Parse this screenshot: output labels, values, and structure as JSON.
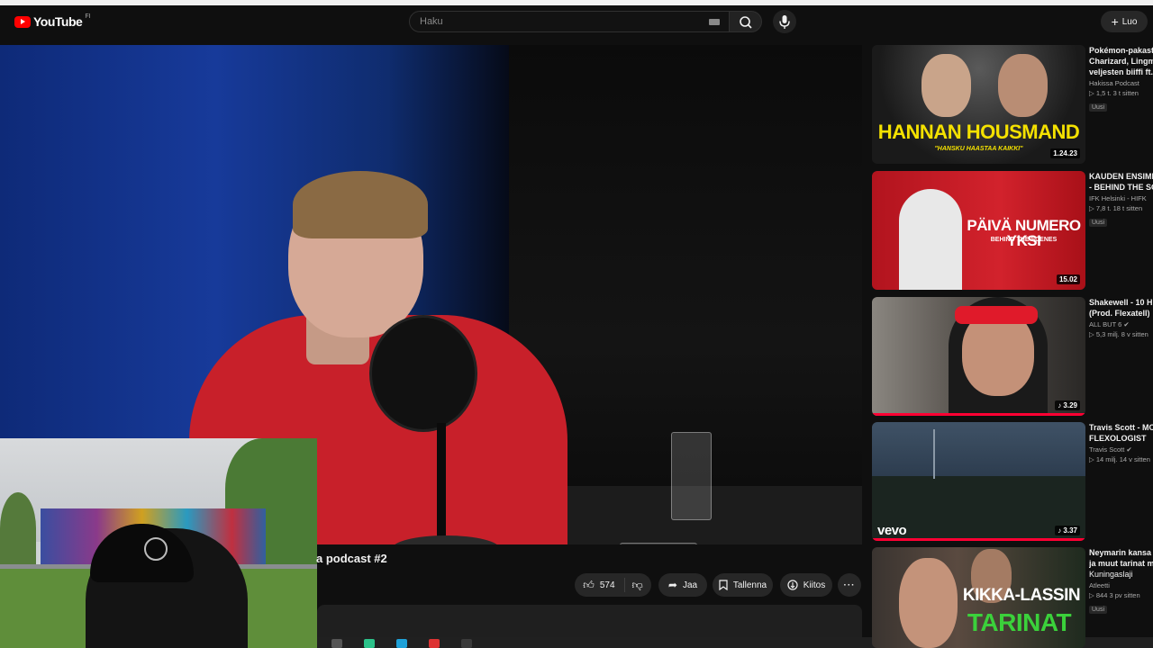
{
  "masthead": {
    "logo_text": "YouTube",
    "country_code": "FI",
    "search_placeholder": "Haku",
    "create_label": "Luo"
  },
  "video": {
    "title": "a podcast #2",
    "likes": "574",
    "share_label": "Jaa",
    "save_label": "Tallenna",
    "thanks_label": "Kiitos"
  },
  "recommendations": [
    {
      "title_line1": "Pokémon-pakast",
      "title_line2": "Charizard, Lingm",
      "title_line3": "veljesten biiffi ft.",
      "channel": "Hakissa Podcast",
      "stats": "▷ 1,5 t.  3 t sitten",
      "badge": "Uusi",
      "duration": "1.24.23",
      "thumb_headline": "HANNAN HOUSMAND",
      "thumb_sub": "\"HANSKU HAASTAA KAIKKI\""
    },
    {
      "title_line1": "KAUDEN ENSIMM",
      "title_line2": "- BEHIND THE SC",
      "title_line3": "",
      "channel": "IFK Helsinki - HIFK",
      "stats": "▷ 7,8 t.  18 t sitten",
      "badge": "Uusi",
      "duration": "15.02",
      "thumb_headline": "PÄIVÄ NUMERO YKSI",
      "thumb_sub": "BEHIND THE SCENES"
    },
    {
      "title_line1": "Shakewell - 10 H",
      "title_line2": "(Prod. Flexatell)",
      "title_line3": "",
      "channel": "ALL BUT 6",
      "stats": "▷ 5,3 milj.  8 v sitten",
      "badge": "",
      "duration": "♪ 3.29",
      "thumb_headline": "",
      "thumb_sub": ""
    },
    {
      "title_line1": "Travis Scott - MC",
      "title_line2": "FLEXOLOGIST",
      "title_line3": "",
      "channel": "Travis Scott",
      "stats": "▷ 14 milj.  14 v sitten",
      "badge": "",
      "duration": "♪ 3.37",
      "thumb_headline": "vevo",
      "thumb_sub": ""
    },
    {
      "title_line1": "Neymarin kansa",
      "title_line2": "ja muut tarinat m",
      "title_line3": "Kuningaslaji",
      "channel": "Atleetti",
      "stats": "▷ 844  3 pv sitten",
      "badge": "Uusi",
      "duration": "",
      "thumb_headline": "KIKKA-LASSIN",
      "thumb_sub": "TARINAT"
    }
  ],
  "colors": {
    "background": "#0f0f0f",
    "accent_red": "#ff0000",
    "thumb_yellow": "#f4e100",
    "progress_red": "#ff0033"
  }
}
